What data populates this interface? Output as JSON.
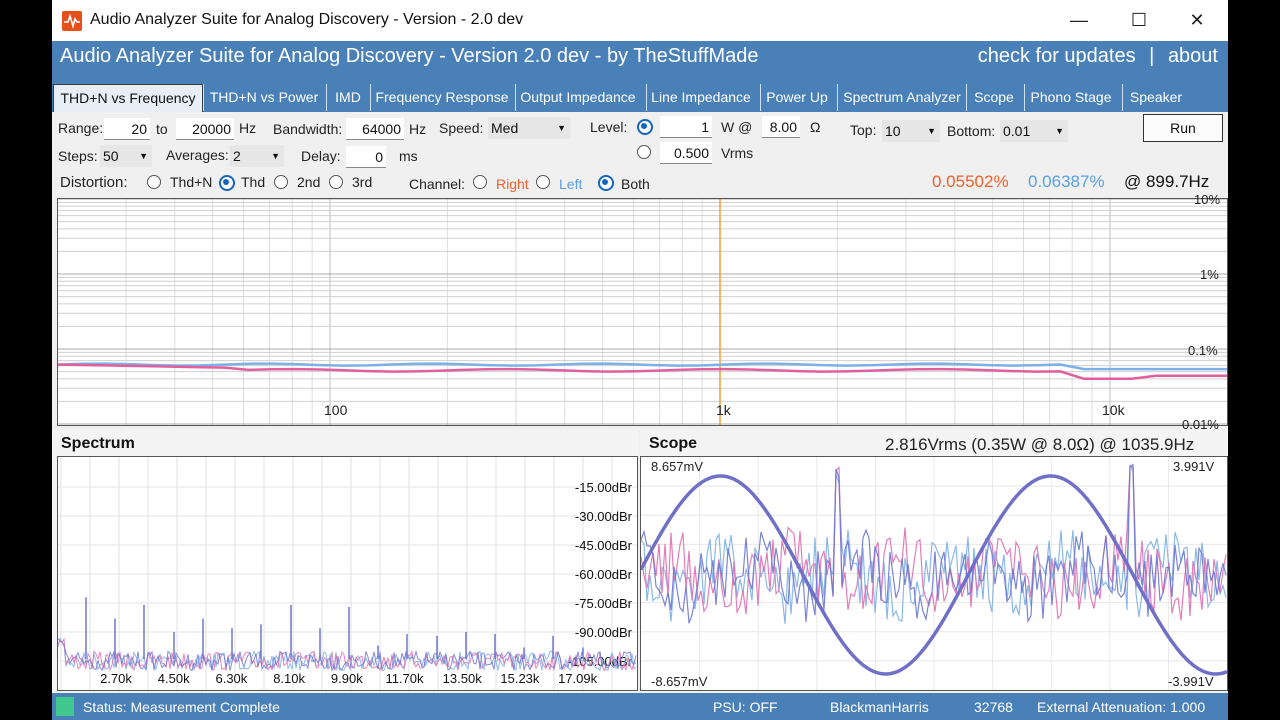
{
  "window": {
    "title": "Audio Analyzer Suite for Analog Discovery - Version - 2.0 dev",
    "minimize": "—",
    "maximize": "☐",
    "close": "✕"
  },
  "header": {
    "title": "Audio Analyzer Suite for Analog Discovery - Version  2.0 dev  - by TheStuffMade",
    "updates": "check for updates",
    "sep": "|",
    "about": "about"
  },
  "tabs": [
    "THD+N vs Frequency",
    "THD+N vs Power",
    "IMD",
    "Frequency Response",
    "Output Impedance",
    "Line Impedance",
    "Power Up",
    "Spectrum Analyzer",
    "Scope",
    "Phono Stage",
    "Speaker"
  ],
  "controls": {
    "range_label": "Range:",
    "range_from": "20",
    "to_label": "to",
    "range_to": "20000",
    "hz": "Hz",
    "bandwidth_label": "Bandwidth:",
    "bandwidth": "64000",
    "bw_hz": "Hz",
    "speed_label": "Speed:",
    "speed": "Med",
    "level_label": "Level:",
    "level_w": "1",
    "w_at": "W @",
    "ohms": "8.00",
    "ohm_unit": "Ω",
    "level_v": "0.500",
    "vrms": "Vrms",
    "top_label": "Top:",
    "top": "10",
    "bottom_label": "Bottom:",
    "bottom": "0.01",
    "run": "Run",
    "steps_label": "Steps:",
    "steps": "50",
    "averages_label": "Averages:",
    "averages": "2",
    "delay_label": "Delay:",
    "delay": "0",
    "ms": "ms",
    "distortion_label": "Distortion:",
    "dist_opts": [
      "Thd+N",
      "Thd",
      "2nd",
      "3rd"
    ],
    "dist_selected": "Thd",
    "channel_label": "Channel:",
    "ch_opts": [
      "Right",
      "Left",
      "Both"
    ],
    "ch_selected": "Both",
    "result_right": "0.05502%",
    "result_left": "0.06387%",
    "result_freq": "@ 899.7Hz",
    "color_right": "#f0602a",
    "color_left": "#5aa0e6"
  },
  "thd_plot": {
    "x_ticks": [
      "100",
      "1k",
      "10k"
    ],
    "y_ticks": [
      "10%",
      "1%",
      "0.1%",
      "0.01%"
    ],
    "cursor_freq": "1k",
    "right_color": "#e0609c",
    "left_color": "#7eb0e8",
    "cursor_color": "#f0a030"
  },
  "spectrum": {
    "title": "Spectrum",
    "y_ticks": [
      "-15.00dBr",
      "-30.00dBr",
      "-45.00dBr",
      "-60.00dBr",
      "-75.00dBr",
      "-90.00dBr",
      "-105.00dBr"
    ],
    "x_ticks": [
      "2.70k",
      "4.50k",
      "6.30k",
      "8.10k",
      "9.90k",
      "11.70k",
      "13.50k",
      "15.23k",
      "17.09k"
    ]
  },
  "scope": {
    "title": "Scope",
    "readout": "2.816Vrms (0.35W @ 8.0Ω) @ 1035.9Hz",
    "left_top": "8.657mV",
    "left_bottom": "-8.657mV",
    "right_top": "3.991V",
    "right_bottom": "-3.991V"
  },
  "status": {
    "message": "Status: Measurement Complete",
    "psu": "PSU: OFF",
    "window": "BlackmanHarris",
    "fft": "32768",
    "attenuation": "External Attenuation: 1.000"
  }
}
